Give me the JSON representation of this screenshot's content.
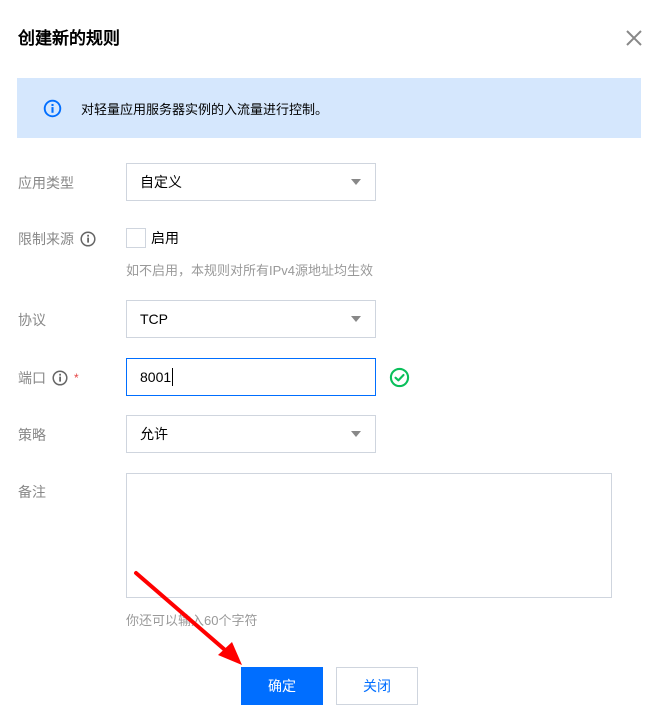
{
  "dialog": {
    "title": "创建新的规则",
    "close_icon": "close-icon"
  },
  "notice": {
    "icon": "info-icon",
    "text": "对轻量应用服务器实例的入流量进行控制。",
    "colors": {
      "background": "#d5e7fd",
      "icon": "#006eff"
    }
  },
  "form": {
    "app_type": {
      "label": "应用类型",
      "value": "自定义"
    },
    "source_limit": {
      "label": "限制来源",
      "help_icon": "info-icon",
      "checkbox_label": "启用",
      "checked": false,
      "hint": "如不启用，本规则对所有IPv4源地址均生效"
    },
    "protocol": {
      "label": "协议",
      "value": "TCP"
    },
    "port": {
      "label": "端口",
      "help_icon": "info-icon",
      "required_mark": "*",
      "value": "8001",
      "valid_icon": "check-circle-icon"
    },
    "policy": {
      "label": "策略",
      "value": "允许"
    },
    "remark": {
      "label": "备注",
      "value": "",
      "hint": "你还可以输入60个字符"
    }
  },
  "footer": {
    "confirm_label": "确定",
    "close_label": "关闭"
  },
  "colors": {
    "primary": "#006eff",
    "success": "#0abf5b",
    "required": "#e54545",
    "annotation_arrow": "#ff0000"
  }
}
